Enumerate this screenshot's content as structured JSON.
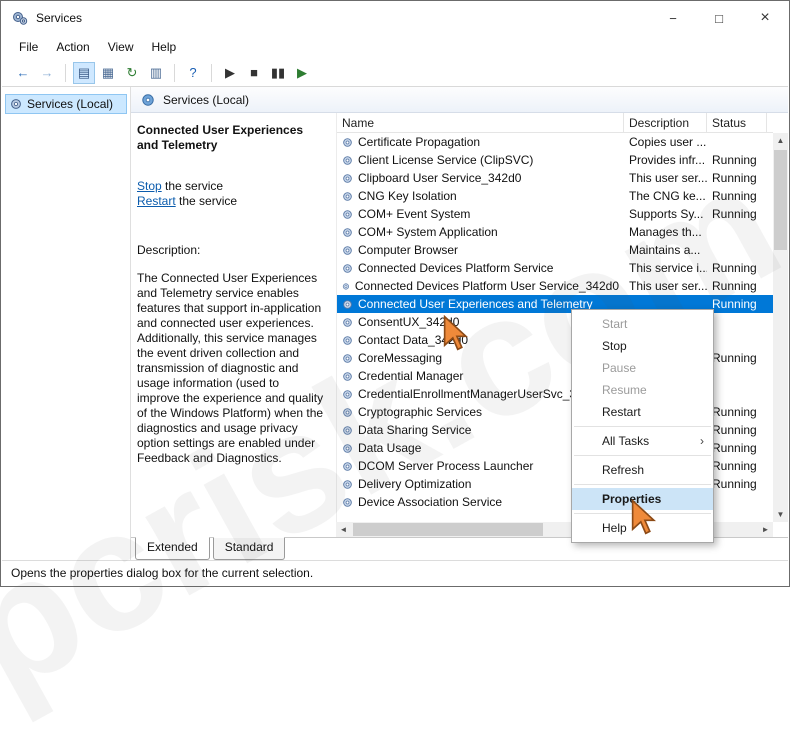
{
  "window": {
    "title": "Services",
    "controls": {
      "minimize": "−",
      "maximize": "□",
      "close": "×"
    }
  },
  "menu": {
    "items": [
      "File",
      "Action",
      "View",
      "Help"
    ]
  },
  "toolbar": {
    "buttons": [
      {
        "id": "back",
        "glyph": "←",
        "color": "#2f6fba"
      },
      {
        "id": "forward",
        "glyph": "→",
        "color": "#8fb0d6"
      },
      {
        "separator": true
      },
      {
        "id": "show-hide-console-tree",
        "glyph": "▤",
        "pressed": true,
        "color": "#3a5a86"
      },
      {
        "id": "properties",
        "glyph": "▦",
        "color": "#4a6a93"
      },
      {
        "id": "refresh",
        "glyph": "↻",
        "color": "#2e7d32"
      },
      {
        "id": "export-list",
        "glyph": "▥",
        "color": "#4a6a93"
      },
      {
        "separator": true
      },
      {
        "id": "help",
        "glyph": "?",
        "color": "#1a5fb4"
      },
      {
        "separator": true
      },
      {
        "id": "start-service",
        "glyph": "▶",
        "color": "#333333"
      },
      {
        "id": "stop-service",
        "glyph": "■",
        "color": "#333333"
      },
      {
        "id": "pause-service",
        "glyph": "▮▮",
        "color": "#333333"
      },
      {
        "id": "restart-service",
        "glyph": "▶",
        "color": "#2e7d32"
      }
    ]
  },
  "sidebar": {
    "root": "Services (Local)"
  },
  "header": {
    "title": "Services (Local)"
  },
  "detail_pane": {
    "service_title": "Connected User Experiences and Telemetry",
    "stop_link": "Stop",
    "stop_suffix": " the service",
    "restart_link": "Restart",
    "restart_suffix": " the service",
    "description_label": "Description:",
    "description_text": "The Connected User Experiences and Telemetry service enables features that support in-application and connected user experiences. Additionally, this service manages the event driven collection and transmission of diagnostic and usage information (used to improve the experience and quality of the Windows Platform) when the diagnostics and usage privacy option settings are enabled under Feedback and Diagnostics."
  },
  "services_list": {
    "columns": [
      "Name",
      "Description",
      "Status"
    ],
    "rows": [
      {
        "name": "Certificate Propagation",
        "description": "Copies user ...",
        "status": ""
      },
      {
        "name": "Client License Service (ClipSVC)",
        "description": "Provides infr...",
        "status": "Running"
      },
      {
        "name": "Clipboard User Service_342d0",
        "description": "This user ser...",
        "status": "Running"
      },
      {
        "name": "CNG Key Isolation",
        "description": "The CNG ke...",
        "status": "Running"
      },
      {
        "name": "COM+ Event System",
        "description": "Supports Sy...",
        "status": "Running"
      },
      {
        "name": "COM+ System Application",
        "description": "Manages th...",
        "status": ""
      },
      {
        "name": "Computer Browser",
        "description": "Maintains a...",
        "status": ""
      },
      {
        "name": "Connected Devices Platform Service",
        "description": "This service i...",
        "status": "Running"
      },
      {
        "name": "Connected Devices Platform User Service_342d0",
        "description": "This user ser...",
        "status": "Running"
      },
      {
        "name": "Connected User Experiences and Telemetry",
        "description": "",
        "status": "Running",
        "selected": true
      },
      {
        "name": "ConsentUX_342d0",
        "description": "",
        "status": ""
      },
      {
        "name": "Contact Data_342d0",
        "description": "",
        "status": ""
      },
      {
        "name": "CoreMessaging",
        "description": "",
        "status": "Running"
      },
      {
        "name": "Credential Manager",
        "description": "",
        "status": ""
      },
      {
        "name": "CredentialEnrollmentManagerUserSvc_342d...",
        "description": "",
        "status": ""
      },
      {
        "name": "Cryptographic Services",
        "description": "",
        "status": "Running"
      },
      {
        "name": "Data Sharing Service",
        "description": "",
        "status": "Running"
      },
      {
        "name": "Data Usage",
        "description": "",
        "status": "Running"
      },
      {
        "name": "DCOM Server Process Launcher",
        "description": "",
        "status": "Running"
      },
      {
        "name": "Delivery Optimization",
        "description": "",
        "status": "Running"
      },
      {
        "name": "Device Association Service",
        "description": "",
        "status": ""
      }
    ]
  },
  "context_menu": {
    "items": [
      {
        "label": "Start",
        "disabled": true
      },
      {
        "label": "Stop"
      },
      {
        "label": "Pause",
        "disabled": true
      },
      {
        "label": "Resume",
        "disabled": true
      },
      {
        "label": "Restart",
        "separator_after": true
      },
      {
        "label": "All Tasks",
        "submenu": true,
        "separator_after": true
      },
      {
        "label": "Refresh",
        "separator_after": true
      },
      {
        "label": "Properties",
        "highlighted": true,
        "separator_after": true
      },
      {
        "label": "Help"
      }
    ]
  },
  "tabs": {
    "items": [
      {
        "label": "Extended",
        "active": true
      },
      {
        "label": "Standard",
        "active": false
      }
    ]
  },
  "status_bar": {
    "text": "Opens the properties dialog box for the current selection."
  },
  "watermark": {
    "text": "pcrisk.com"
  },
  "colors": {
    "selection_bg": "#0078d7",
    "selection_text": "#ffffff",
    "menu_highlight": "#cce4f7",
    "link": "#0b5cad",
    "annotation_arrow": "#ef8a3a"
  }
}
